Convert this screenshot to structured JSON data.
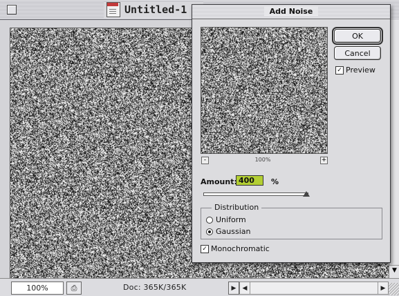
{
  "document": {
    "title": "Untitled-1 @",
    "zoom": "100%",
    "size_info": "Doc: 365K/365K"
  },
  "dialog": {
    "title": "Add Noise",
    "ok_label": "OK",
    "cancel_label": "Cancel",
    "preview_label": "Preview",
    "preview_checked": true,
    "preview_zoom": "100%",
    "zoom_out_symbol": "-",
    "zoom_in_symbol": "+",
    "amount_label": "Amount:",
    "amount_value": "400",
    "amount_unit": "%",
    "distribution_label": "Distribution",
    "distribution_options": [
      "Uniform",
      "Gaussian"
    ],
    "distribution_selected": "Gaussian",
    "monochromatic_label": "Monochromatic",
    "monochromatic_checked": true
  },
  "icons": {
    "check": "✓",
    "arrow_right": "▶",
    "arrow_left": "◀",
    "arrow_down": "▼",
    "doc_info": "⎙"
  }
}
